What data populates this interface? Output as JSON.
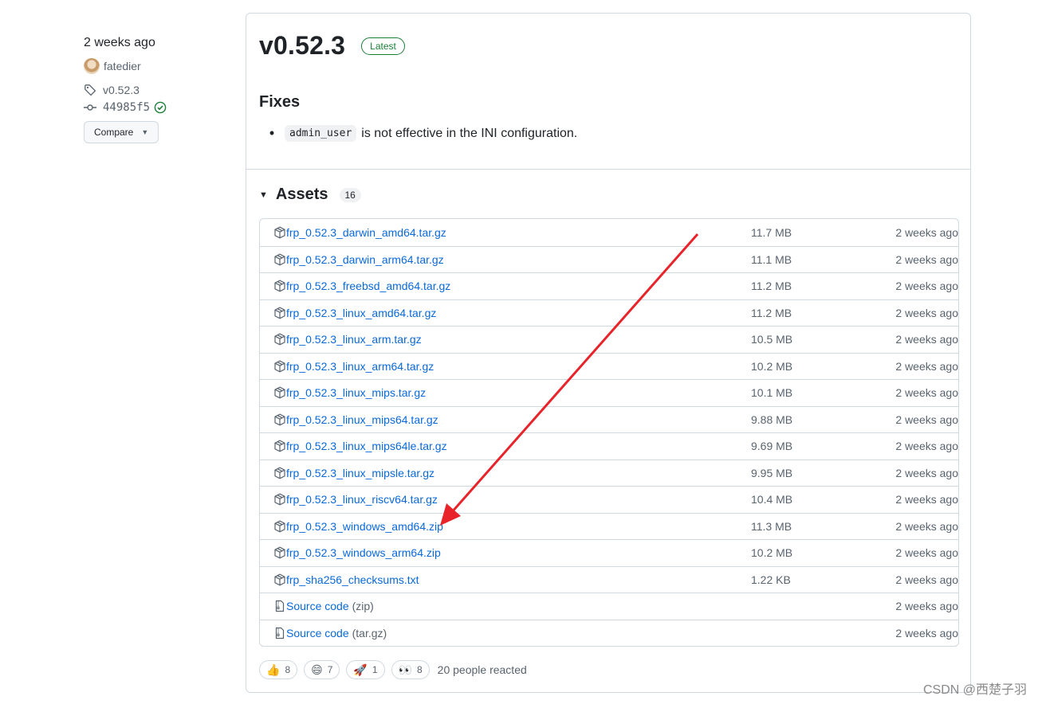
{
  "meta": {
    "released": "2 weeks ago",
    "author": "fatedier",
    "tag": "v0.52.3",
    "commit": "44985f5",
    "compare_label": "Compare"
  },
  "release": {
    "title": "v0.52.3",
    "latest_badge": "Latest",
    "fixes_heading": "Fixes",
    "fix_code": "admin_user",
    "fix_text": "is not effective in the INI configuration."
  },
  "assets": {
    "heading": "Assets",
    "count": "16",
    "items": [
      {
        "name": "frp_0.52.3_darwin_amd64.tar.gz",
        "size": "11.7 MB",
        "date": "2 weeks ago"
      },
      {
        "name": "frp_0.52.3_darwin_arm64.tar.gz",
        "size": "11.1 MB",
        "date": "2 weeks ago"
      },
      {
        "name": "frp_0.52.3_freebsd_amd64.tar.gz",
        "size": "11.2 MB",
        "date": "2 weeks ago"
      },
      {
        "name": "frp_0.52.3_linux_amd64.tar.gz",
        "size": "11.2 MB",
        "date": "2 weeks ago"
      },
      {
        "name": "frp_0.52.3_linux_arm.tar.gz",
        "size": "10.5 MB",
        "date": "2 weeks ago"
      },
      {
        "name": "frp_0.52.3_linux_arm64.tar.gz",
        "size": "10.2 MB",
        "date": "2 weeks ago"
      },
      {
        "name": "frp_0.52.3_linux_mips.tar.gz",
        "size": "10.1 MB",
        "date": "2 weeks ago"
      },
      {
        "name": "frp_0.52.3_linux_mips64.tar.gz",
        "size": "9.88 MB",
        "date": "2 weeks ago"
      },
      {
        "name": "frp_0.52.3_linux_mips64le.tar.gz",
        "size": "9.69 MB",
        "date": "2 weeks ago"
      },
      {
        "name": "frp_0.52.3_linux_mipsle.tar.gz",
        "size": "9.95 MB",
        "date": "2 weeks ago"
      },
      {
        "name": "frp_0.52.3_linux_riscv64.tar.gz",
        "size": "10.4 MB",
        "date": "2 weeks ago"
      },
      {
        "name": "frp_0.52.3_windows_amd64.zip",
        "size": "11.3 MB",
        "date": "2 weeks ago"
      },
      {
        "name": "frp_0.52.3_windows_arm64.zip",
        "size": "10.2 MB",
        "date": "2 weeks ago"
      },
      {
        "name": "frp_sha256_checksums.txt",
        "size": "1.22 KB",
        "date": "2 weeks ago"
      }
    ],
    "source": [
      {
        "name": "Source code",
        "format": "(zip)",
        "date": "2 weeks ago"
      },
      {
        "name": "Source code",
        "format": "(tar.gz)",
        "date": "2 weeks ago"
      }
    ]
  },
  "reactions": {
    "items": [
      {
        "emoji": "👍",
        "count": "8"
      },
      {
        "emoji": "😄",
        "count": "7"
      },
      {
        "emoji": "🚀",
        "count": "1"
      },
      {
        "emoji": "👀",
        "count": "8"
      }
    ],
    "summary": "20 people reacted"
  },
  "watermark": "CSDN @西楚子羽",
  "colors": {
    "link": "#0969da",
    "success": "#1a7f37",
    "annotation_arrow": "#e8232a"
  }
}
